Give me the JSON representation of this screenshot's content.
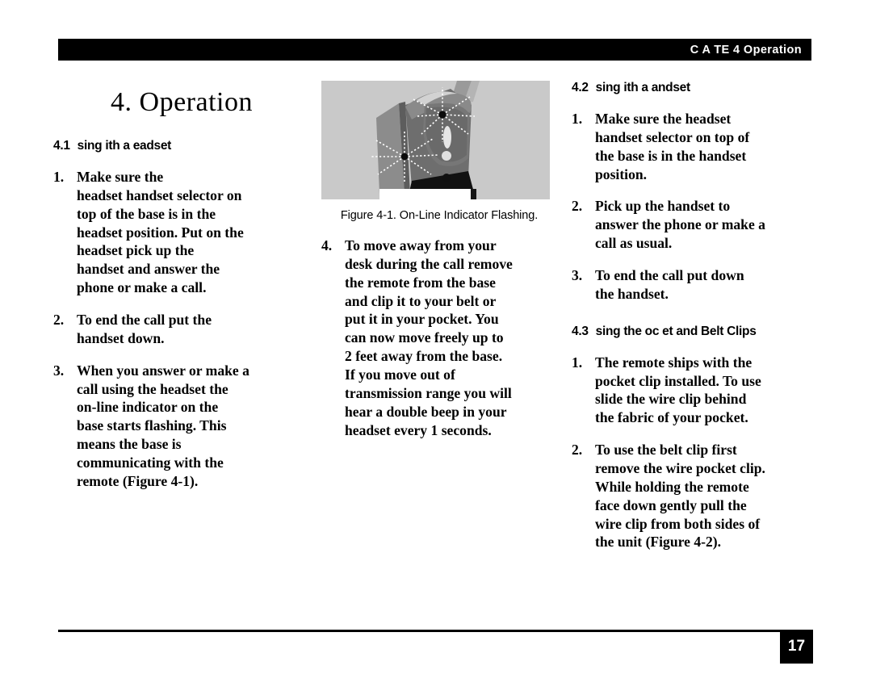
{
  "header": {
    "title": "C A TE  4  Operation"
  },
  "chapter": {
    "title": "4. Operation"
  },
  "sections": {
    "s41": {
      "number": "4.1",
      "title": "sing  ith a  eadset",
      "items": [
        {
          "mark": "1.",
          "lines": [
            "Make sure the",
            "headset  handset selector on",
            "top of the base is in the",
            "headset position. Put on the",
            "headset  pick up the",
            "handset  and answer the",
            "phone or make a call."
          ]
        },
        {
          "mark": "2.",
          "lines": [
            "To end the call  put the",
            "handset down."
          ]
        },
        {
          "mark": "3.",
          "lines": [
            "When you answer or make a",
            "call using the headset  the",
            "on-line indicator on the",
            "base starts flashing. This",
            "means the base is",
            "communicating with the",
            "remote (Figure 4-1)."
          ]
        }
      ]
    },
    "s42": {
      "number": "4.2",
      "title": "sing  ith a  andset",
      "items": [
        {
          "mark": "1.",
          "lines": [
            " Make sure the headset",
            "handset selector on top of",
            "the base is in the handset",
            "position."
          ]
        },
        {
          "mark": "2.",
          "lines": [
            "Pick up the handset to",
            "answer the phone or make a",
            "call as usual."
          ]
        },
        {
          "mark": "3.",
          "lines": [
            "To end the call  put down",
            "the handset."
          ]
        }
      ]
    },
    "s43": {
      "number": "4.3",
      "title": "sing the  oc et and Belt Clips",
      "items": [
        {
          "mark": "1.",
          "lines": [
            "The remote ships with the",
            "pocket clip installed. To use",
            "slide the wire clip behind",
            "the fabric of your pocket."
          ]
        },
        {
          "mark": "2.",
          "lines": [
            "To use the belt clip  first",
            "remove the wire pocket clip.",
            "While holding the remote",
            "face down  gently pull the",
            "wire clip from both sides of",
            "the unit (Figure 4-2)."
          ]
        }
      ]
    }
  },
  "figure": {
    "caption": "Figure 4-1. On-Line Indicator Flashing.",
    "alt": "phone-base-with-flashing-indicators"
  },
  "mid_column": {
    "items": [
      {
        "mark": "4.",
        "lines": [
          "To move away from your",
          "desk during the call  remove",
          "the remote from the base",
          "and clip it to your belt or",
          "put it in your pocket. You",
          "can now move freely up to",
          "2    feet away from the base.",
          "If you move out of",
          "transmission range  you will",
          "hear a double beep in your",
          "headset every 1   seconds."
        ]
      }
    ]
  },
  "footer": {
    "page_number": "17"
  },
  "colors": {
    "ink": "#000000",
    "paper": "#ffffff",
    "figure_background": "#c9c9c9"
  }
}
